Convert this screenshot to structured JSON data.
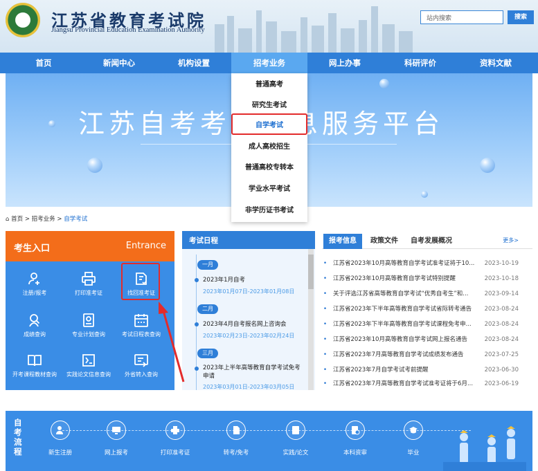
{
  "header": {
    "title": "江苏省教育考试院",
    "subtitle": "Jiangsu Provincial Education Examination Authority",
    "search_placeholder": "站内搜索",
    "search_button": "搜索"
  },
  "nav": [
    "首页",
    "新闻中心",
    "机构设置",
    "招考业务",
    "网上办事",
    "科研评价",
    "资料文献"
  ],
  "nav_active_index": 3,
  "banner": {
    "title": "江苏自考考试信息服务平台"
  },
  "dropdown": [
    "普通高考",
    "研究生考试",
    "自学考试",
    "成人高校招生",
    "普通高校专转本",
    "学业水平考试",
    "非学历证书考试"
  ],
  "dropdown_selected_index": 2,
  "breadcrumb": [
    "首页",
    "招考业务",
    "自学考试"
  ],
  "entrance": {
    "title": "考生入口",
    "title_en": "Entrance",
    "items": [
      {
        "label": "注册/报考",
        "icon": "user-add-icon"
      },
      {
        "label": "打印准考证",
        "icon": "printer-icon"
      },
      {
        "label": "找回准考证",
        "icon": "recover-card-icon"
      },
      {
        "label": "成绩查询",
        "icon": "score-search-icon"
      },
      {
        "label": "专业计划查询",
        "icon": "plan-icon"
      },
      {
        "label": "考试日程表查询",
        "icon": "calendar-icon"
      },
      {
        "label": "开考课程教材查询",
        "icon": "book-icon"
      },
      {
        "label": "实践论文信息查询",
        "icon": "paper-icon"
      },
      {
        "label": "外省转入查询",
        "icon": "transfer-icon"
      }
    ]
  },
  "schedule": {
    "title": "考试日程",
    "events": [
      {
        "month": "一月",
        "title": "2023年1月自考",
        "date": "2023年01月07日-2023年01月08日"
      },
      {
        "month": "二月",
        "title": "2023年4月自考报名网上咨询会",
        "date": "2023年02月23日-2023年02月24日"
      },
      {
        "month": "三月",
        "title": "2023年上半年高等教育自学考试免考申请",
        "date": "2023年03月01日-2023年03月05日"
      }
    ]
  },
  "news": {
    "tabs": [
      "报考信息",
      "政策文件",
      "自考发展概况"
    ],
    "more": "更多>",
    "items": [
      {
        "title": "江苏省2023年10月高等教育自学考试准考证将于10...",
        "date": "2023-10-19"
      },
      {
        "title": "江苏省2023年10月高等教育自学考试特别提醒",
        "date": "2023-10-18"
      },
      {
        "title": "关于评选江苏省高等教育自学考试“优秀自考生”和...",
        "date": "2023-09-14"
      },
      {
        "title": "江苏省2023年下半年高等教育自学考试省际转考通告",
        "date": "2023-08-24"
      },
      {
        "title": "江苏省2023年下半年高等教育自学考试课程免考申...",
        "date": "2023-08-24"
      },
      {
        "title": "江苏省2023年10月高等教育自学考试网上报名通告",
        "date": "2023-08-24"
      },
      {
        "title": "江苏省2023年7月高等教育自学考试成绩发布通告",
        "date": "2023-07-25"
      },
      {
        "title": "江苏省2023年7月自学考试考前提醒",
        "date": "2023-06-30"
      },
      {
        "title": "江苏省2023年7月高等教育自学考试准考证将于6月...",
        "date": "2023-06-19"
      }
    ]
  },
  "flow": {
    "label": "自考流程",
    "steps": [
      "新生注册",
      "网上报考",
      "打印准考证",
      "转考/免考",
      "实践/论文",
      "本科资审",
      "毕业"
    ]
  }
}
